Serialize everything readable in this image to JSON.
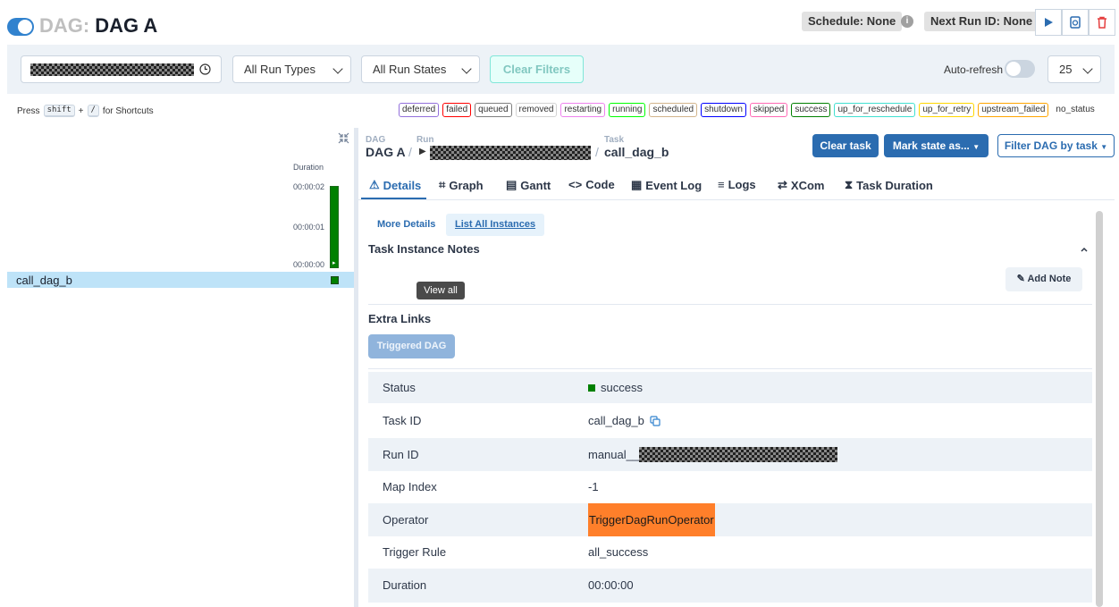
{
  "header": {
    "title_prefix": "DAG:",
    "dag_name": "DAG A",
    "schedule": "Schedule: None",
    "next_run": "Next Run ID: None",
    "info_glyph": "i"
  },
  "filters": {
    "run_types": "All Run Types",
    "run_states": "All Run States",
    "clear_filters": "Clear Filters",
    "auto_refresh": "Auto-refresh",
    "page_size": "25"
  },
  "shortcut_hint": {
    "press": "Press",
    "key1": "shift",
    "plus": "+",
    "key2": "/",
    "suffix": "for Shortcuts"
  },
  "legend": [
    {
      "label": "deferred",
      "color": "#9370db"
    },
    {
      "label": "failed",
      "color": "#ff0000"
    },
    {
      "label": "queued",
      "color": "#808080"
    },
    {
      "label": "removed",
      "color": "#d3d3d3"
    },
    {
      "label": "restarting",
      "color": "#ee82ee"
    },
    {
      "label": "running",
      "color": "#00ff00"
    },
    {
      "label": "scheduled",
      "color": "#d2b48c"
    },
    {
      "label": "shutdown",
      "color": "#0000ff"
    },
    {
      "label": "skipped",
      "color": "#ff69b4"
    },
    {
      "label": "success",
      "color": "#008000"
    },
    {
      "label": "up_for_reschedule",
      "color": "#40e0d0"
    },
    {
      "label": "up_for_retry",
      "color": "#ffd700"
    },
    {
      "label": "upstream_failed",
      "color": "#ffa500"
    },
    {
      "label": "no_status",
      "color": "#ffffff"
    }
  ],
  "grid": {
    "duration_label": "Duration",
    "ticks": [
      "00:00:02",
      "00:00:01",
      "00:00:00"
    ],
    "task_name": "call_dag_b"
  },
  "breadcrumb": {
    "dag_label": "DAG",
    "dag_value": "DAG A",
    "run_label": "Run",
    "task_label": "Task",
    "task_value": "call_dag_b"
  },
  "actions": {
    "clear_task": "Clear task",
    "mark_state": "Mark state as...",
    "filter_dag": "Filter DAG by task"
  },
  "tabs": [
    "Details",
    "Graph",
    "Gantt",
    "Code",
    "Event Log",
    "Logs",
    "XCom",
    "Task Duration"
  ],
  "subtabs": {
    "more_details": "More Details",
    "list_all": "List All Instances"
  },
  "notes": {
    "title": "Task Instance Notes",
    "add_note": "Add Note",
    "tooltip": "View all"
  },
  "extra_links": {
    "title": "Extra Links",
    "triggered_dag": "Triggered DAG"
  },
  "details": {
    "status_key": "Status",
    "status_val": "success",
    "task_id_key": "Task ID",
    "task_id_val": "call_dag_b",
    "run_id_key": "Run ID",
    "run_id_val": "manual__",
    "map_index_key": "Map Index",
    "map_index_val": "-1",
    "operator_key": "Operator",
    "operator_val": "TriggerDagRunOperator",
    "trigger_rule_key": "Trigger Rule",
    "trigger_rule_val": "all_success",
    "duration_key": "Duration",
    "duration_val": "00:00:00"
  }
}
